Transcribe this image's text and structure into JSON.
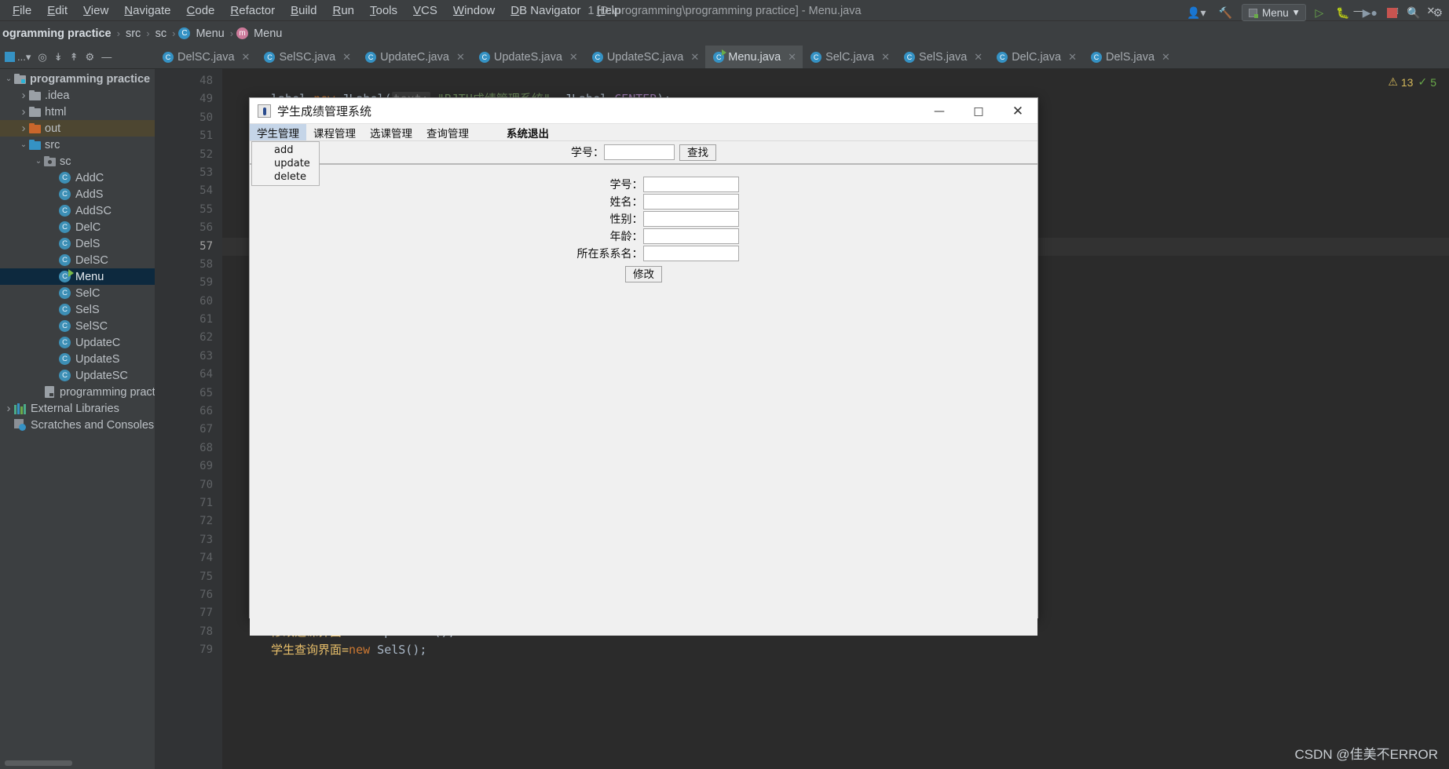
{
  "window": {
    "title": "1 [D:\\programming\\programming practice] - Menu.java",
    "minimize": "—",
    "maximize": "□",
    "close": "✕"
  },
  "menubar": {
    "items": [
      "File",
      "Edit",
      "View",
      "Navigate",
      "Code",
      "Refactor",
      "Build",
      "Run",
      "Tools",
      "VCS",
      "Window",
      "DB Navigator",
      "Help"
    ]
  },
  "navbar": {
    "crumbs": [
      "ogramming practice",
      "src",
      "sc",
      "Menu",
      "Menu"
    ],
    "separator": "›",
    "run_config": "Menu",
    "run_config_caret": "▾",
    "icons": [
      "user-icon",
      "hammer-icon",
      "run-icon",
      "debug-icon",
      "coverage-icon",
      "stop-icon",
      "search-icon",
      "settings-icon"
    ]
  },
  "project_toolbar": {
    "label": "...",
    "caret": "▾",
    "icons": [
      "locate-icon",
      "collapse-icon",
      "expand-icon",
      "settings-icon",
      "hide-icon"
    ]
  },
  "tabs": [
    {
      "label": "DelSC.java",
      "active": false
    },
    {
      "label": "SelSC.java",
      "active": false
    },
    {
      "label": "UpdateC.java",
      "active": false
    },
    {
      "label": "UpdateS.java",
      "active": false
    },
    {
      "label": "UpdateSC.java",
      "active": false
    },
    {
      "label": "Menu.java",
      "active": true
    },
    {
      "label": "SelC.java",
      "active": false
    },
    {
      "label": "SelS.java",
      "active": false
    },
    {
      "label": "DelC.java",
      "active": false
    },
    {
      "label": "DelS.java",
      "active": false
    }
  ],
  "tree": [
    {
      "label": "programming practice",
      "depth": 0,
      "arrow": "v",
      "icon": "module-folder",
      "bold": true,
      "state": "normal"
    },
    {
      "label": ".idea",
      "depth": 1,
      "arrow": ">",
      "icon": "folder-gray",
      "bold": false,
      "state": "normal"
    },
    {
      "label": "html",
      "depth": 1,
      "arrow": ">",
      "icon": "folder-gray",
      "bold": false,
      "state": "normal"
    },
    {
      "label": "out",
      "depth": 1,
      "arrow": ">",
      "icon": "folder-orange",
      "bold": false,
      "state": "highlight"
    },
    {
      "label": "src",
      "depth": 1,
      "arrow": "v",
      "icon": "folder-blue",
      "bold": false,
      "state": "normal"
    },
    {
      "label": "sc",
      "depth": 2,
      "arrow": "v",
      "icon": "folder-package",
      "bold": false,
      "state": "normal"
    },
    {
      "label": "AddC",
      "depth": 3,
      "arrow": "",
      "icon": "class-icon",
      "bold": false,
      "state": "normal"
    },
    {
      "label": "AddS",
      "depth": 3,
      "arrow": "",
      "icon": "class-icon",
      "bold": false,
      "state": "normal"
    },
    {
      "label": "AddSC",
      "depth": 3,
      "arrow": "",
      "icon": "class-icon",
      "bold": false,
      "state": "normal"
    },
    {
      "label": "DelC",
      "depth": 3,
      "arrow": "",
      "icon": "class-icon",
      "bold": false,
      "state": "normal"
    },
    {
      "label": "DelS",
      "depth": 3,
      "arrow": "",
      "icon": "class-icon",
      "bold": false,
      "state": "normal"
    },
    {
      "label": "DelSC",
      "depth": 3,
      "arrow": "",
      "icon": "class-icon",
      "bold": false,
      "state": "normal"
    },
    {
      "label": "Menu",
      "depth": 3,
      "arrow": "",
      "icon": "class-runnable-icon",
      "bold": false,
      "state": "selected"
    },
    {
      "label": "SelC",
      "depth": 3,
      "arrow": "",
      "icon": "class-icon",
      "bold": false,
      "state": "normal"
    },
    {
      "label": "SelS",
      "depth": 3,
      "arrow": "",
      "icon": "class-icon",
      "bold": false,
      "state": "normal"
    },
    {
      "label": "SelSC",
      "depth": 3,
      "arrow": "",
      "icon": "class-icon",
      "bold": false,
      "state": "normal"
    },
    {
      "label": "UpdateC",
      "depth": 3,
      "arrow": "",
      "icon": "class-icon",
      "bold": false,
      "state": "normal"
    },
    {
      "label": "UpdateS",
      "depth": 3,
      "arrow": "",
      "icon": "class-icon",
      "bold": false,
      "state": "normal"
    },
    {
      "label": "UpdateSC",
      "depth": 3,
      "arrow": "",
      "icon": "class-icon",
      "bold": false,
      "state": "normal"
    },
    {
      "label": "programming practice",
      "depth": 2,
      "arrow": "",
      "icon": "iml-icon",
      "bold": false,
      "state": "normal"
    },
    {
      "label": "External Libraries",
      "depth": 0,
      "arrow": ">",
      "icon": "libraries-icon",
      "bold": false,
      "state": "normal"
    },
    {
      "label": "Scratches and Consoles",
      "depth": 0,
      "arrow": "",
      "icon": "scratches-icon",
      "bold": false,
      "state": "normal"
    }
  ],
  "editor": {
    "first_line": 48,
    "current_line": 57,
    "line_count": 32,
    "code_top": {
      "part1": "label=",
      "kw_new": "new",
      "cls": "JLabel",
      "paren": "(",
      "hint": "text:",
      "str": "\"BJTU成绩管理系统\"",
      "comma": ", ",
      "cls2": "JLabel",
      "dot": ".",
      "const": "CENTER"
    },
    "code_bottom_1": {
      "var": "修改选课界面=",
      "kw": "new",
      "cls": "UpdateSC();"
    },
    "code_bottom_2": {
      "var": "学生查询界面=",
      "kw": "new",
      "cls": "SelS();"
    },
    "warnings": "13",
    "weak_warnings": "5",
    "warn_icon": "warning-triangle-icon",
    "weak_icon": "weak-warning-icon"
  },
  "dialog": {
    "title": "学生成绩管理系统",
    "app_icon": "java-coffee-icon",
    "minimize": "—",
    "maximize": "□",
    "close": "✕",
    "menus": [
      {
        "label": "学生管理",
        "active": true,
        "spaced": false
      },
      {
        "label": "课程管理",
        "active": false,
        "spaced": false
      },
      {
        "label": "选课管理",
        "active": false,
        "spaced": false
      },
      {
        "label": "查询管理",
        "active": false,
        "spaced": false
      },
      {
        "label": "系统退出",
        "active": false,
        "spaced": true
      }
    ],
    "popup_items": [
      "add",
      "update",
      "delete"
    ],
    "search": {
      "label": "学号：",
      "value": "",
      "button": "查找"
    },
    "form": {
      "fields": [
        {
          "label": "学号：",
          "value": ""
        },
        {
          "label": "姓名：",
          "value": ""
        },
        {
          "label": "性别：",
          "value": ""
        },
        {
          "label": "年龄：",
          "value": ""
        },
        {
          "label": "所在系系名：",
          "value": ""
        }
      ],
      "submit": "修改"
    }
  },
  "watermark": "CSDN @佳美不ERROR"
}
